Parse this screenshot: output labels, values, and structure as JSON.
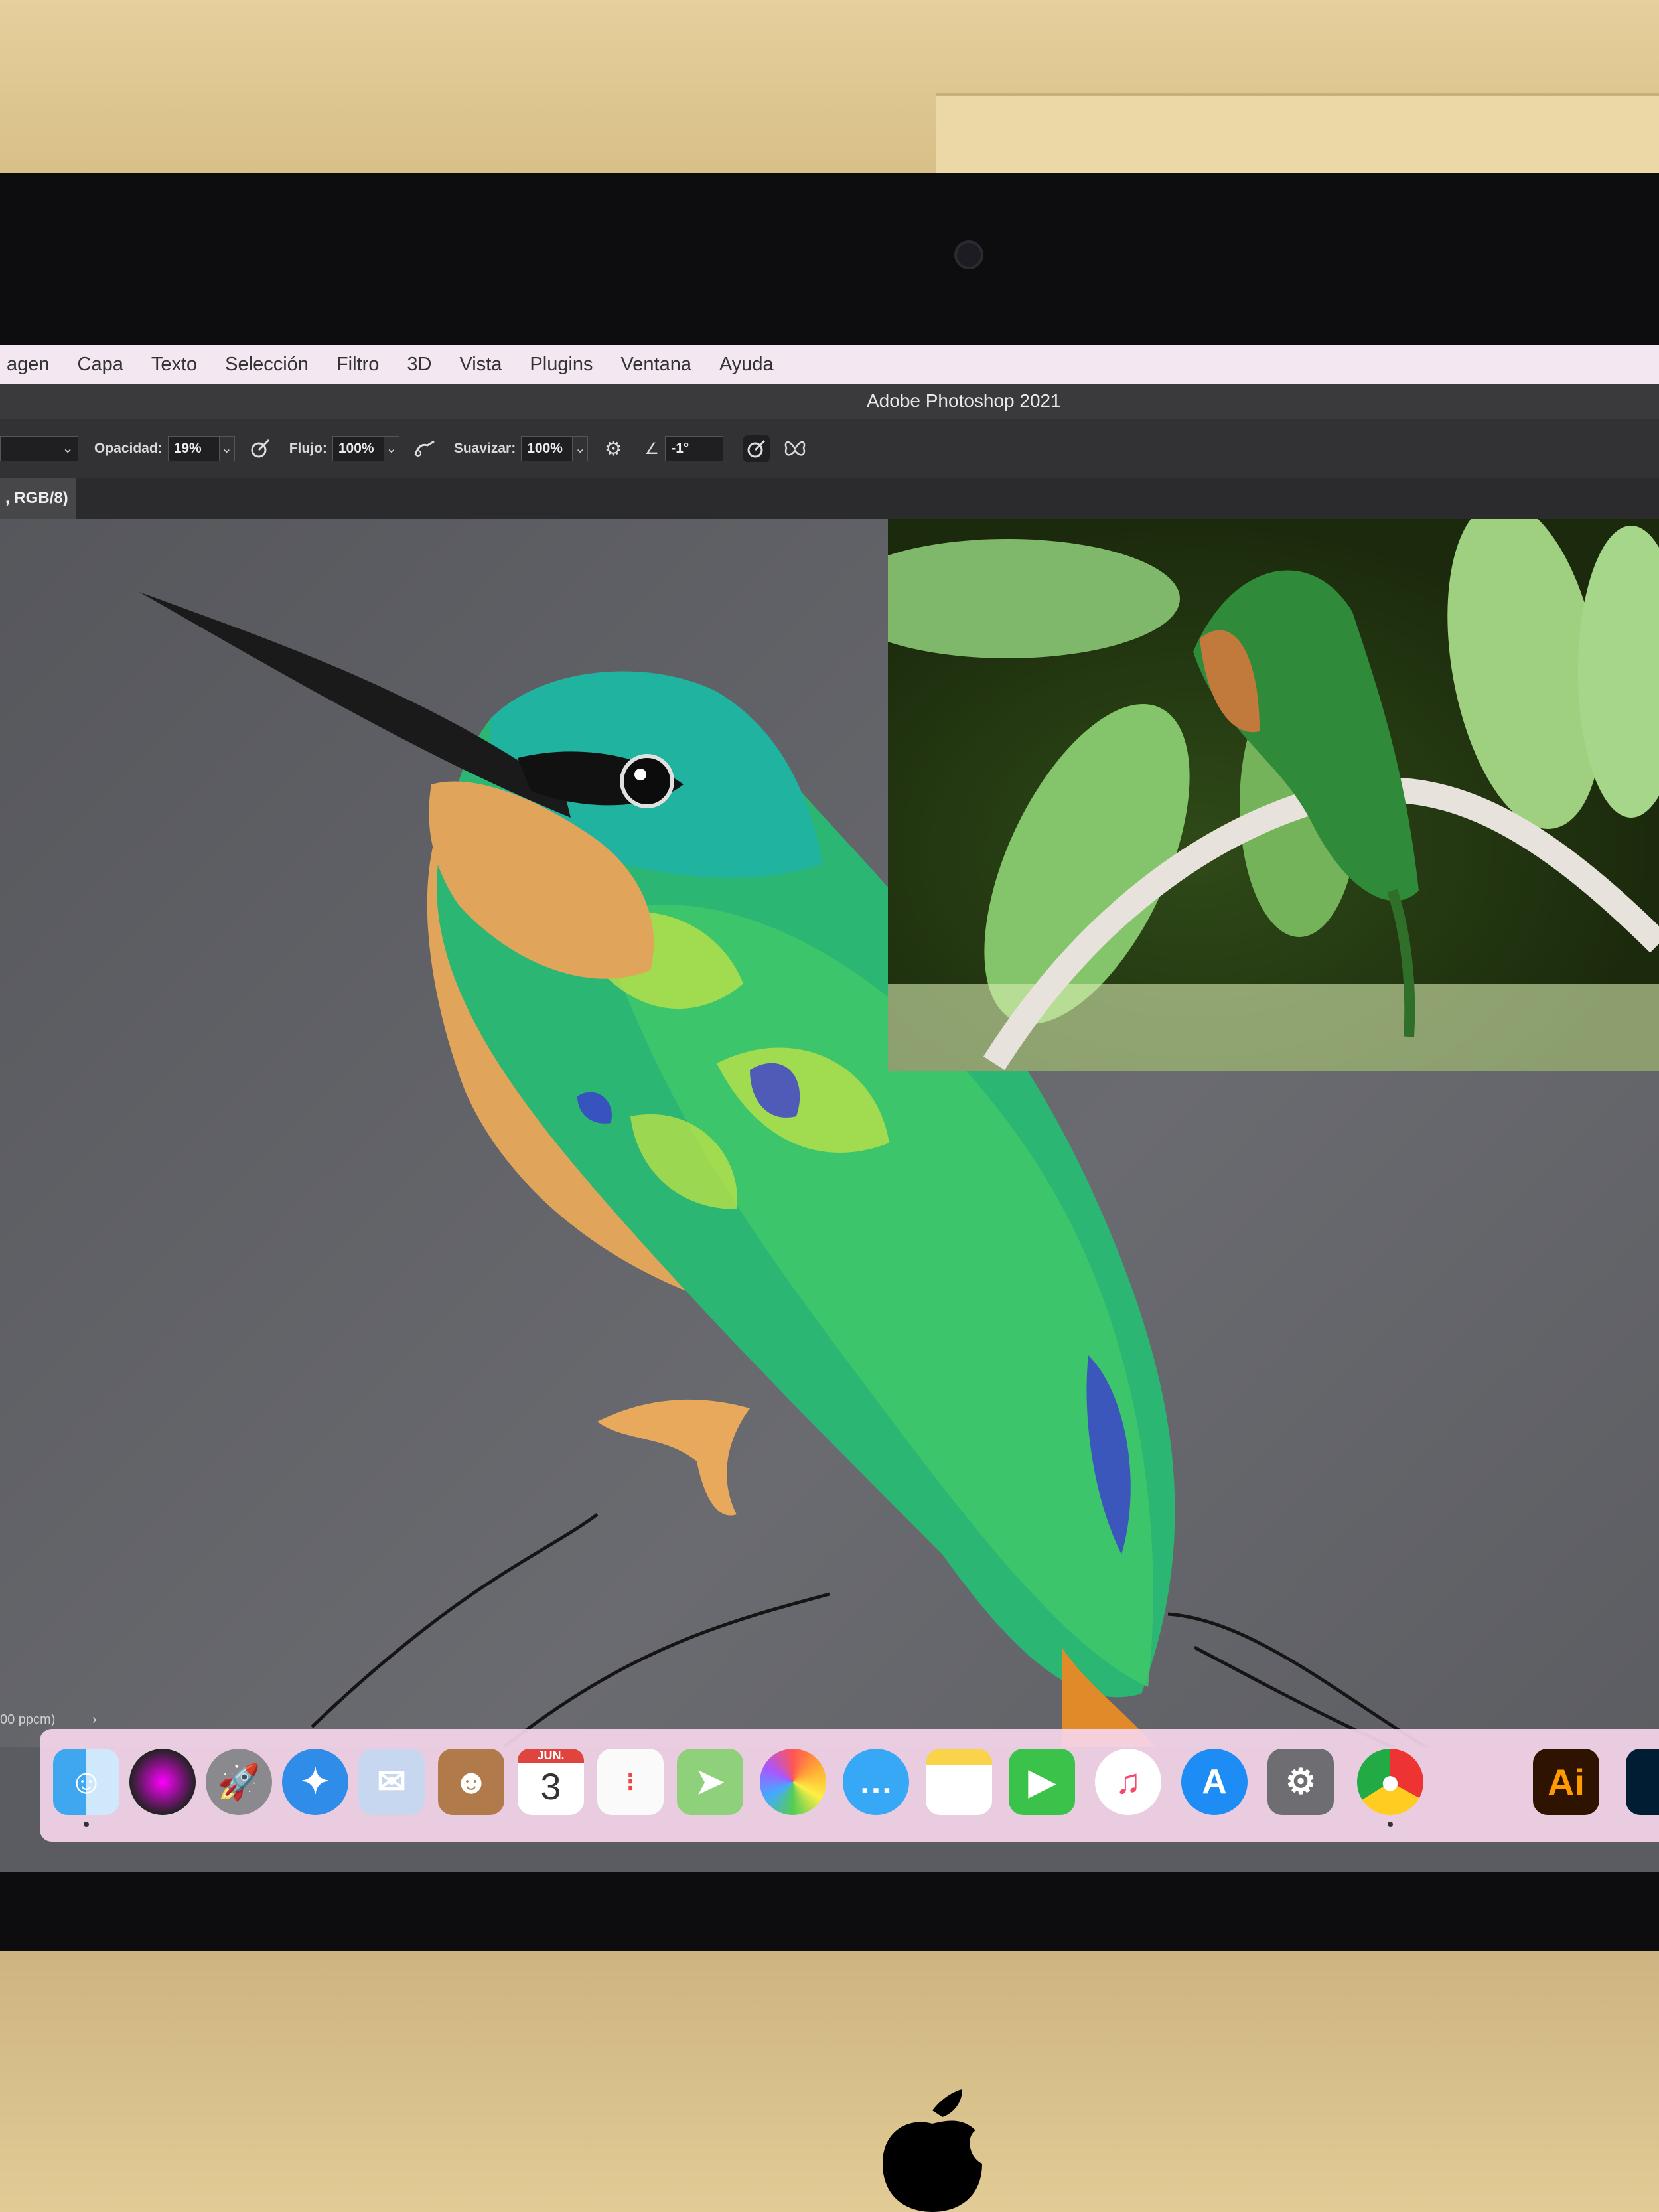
{
  "menubar": {
    "items": [
      "agen",
      "Capa",
      "Texto",
      "Selección",
      "Filtro",
      "3D",
      "Vista",
      "Plugins",
      "Ventana",
      "Ayuda"
    ]
  },
  "app": {
    "title": "Adobe Photoshop 2021"
  },
  "options": {
    "opacity_label": "Opacidad:",
    "opacity_value": "19%",
    "flow_label": "Flujo:",
    "flow_value": "100%",
    "smoothing_label": "Suavizar:",
    "smoothing_value": "100%",
    "angle_value": "-1°"
  },
  "document_tab": {
    "label": ", RGB/8)"
  },
  "status_bar": {
    "text": "00 ppcm)"
  },
  "dock": {
    "calendar_month": "JUN.",
    "calendar_day": "3",
    "illustrator_label": "Ai",
    "icons": [
      "finder-icon",
      "siri-icon",
      "launchpad-icon",
      "safari-icon",
      "mail-icon",
      "contacts-icon",
      "calendar-icon",
      "reminders-icon",
      "maps-icon",
      "photos-icon",
      "messages-icon",
      "notes-icon",
      "facetime-icon",
      "music-icon",
      "app-store-icon",
      "system-preferences-icon",
      "chrome-icon",
      "illustrator-icon",
      "photoshop-icon"
    ]
  },
  "colors": {
    "menubar_bg": "#f3e7f1",
    "photoshop_dark": "#323234",
    "canvas_gray": "#5b5c61",
    "dock_bg": "#f6d6eb",
    "bird_green": "#2bb673",
    "bird_orange": "#e0a55a"
  }
}
